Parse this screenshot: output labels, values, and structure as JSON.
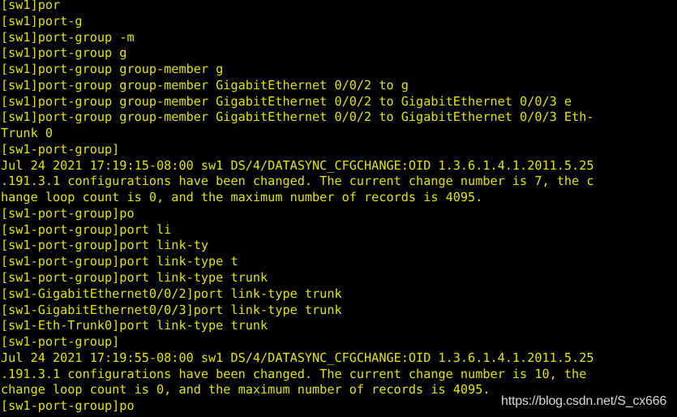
{
  "terminal": {
    "title": "Huawei VRP CLI session",
    "background_color": "#000000",
    "text_color": "#e3e300",
    "device_hostname": "sw1",
    "lines": [
      "[sw1]por",
      "[sw1]port-g",
      "[sw1]port-group -m",
      "[sw1]port-group g",
      "[sw1]port-group group-member g",
      "[sw1]port-group group-member GigabitEthernet 0/0/2 to g",
      "[sw1]port-group group-member GigabitEthernet 0/0/2 to GigabitEthernet 0/0/3 e",
      "[sw1]port-group group-member GigabitEthernet 0/0/2 to GigabitEthernet 0/0/3 Eth-",
      "Trunk 0",
      "[sw1-port-group]",
      "Jul 24 2021 17:19:15-08:00 sw1 DS/4/DATASYNC_CFGCHANGE:OID 1.3.6.1.4.1.2011.5.25",
      ".191.3.1 configurations have been changed. The current change number is 7, the c",
      "hange loop count is 0, and the maximum number of records is 4095.",
      "[sw1-port-group]po",
      "[sw1-port-group]port li",
      "[sw1-port-group]port link-ty",
      "[sw1-port-group]port link-type t",
      "[sw1-port-group]port link-type trunk",
      "[sw1-GigabitEthernet0/0/2]port link-type trunk",
      "[sw1-GigabitEthernet0/0/3]port link-type trunk",
      "[sw1-Eth-Trunk0]port link-type trunk",
      "[sw1-port-group]",
      "Jul 24 2021 17:19:55-08:00 sw1 DS/4/DATASYNC_CFGCHANGE:OID 1.3.6.1.4.1.2011.5.25",
      ".191.3.1 configurations have been changed. The current change number is 10, the ",
      "change loop count is 0, and the maximum number of records is 4095.",
      "[sw1-port-group]po"
    ]
  },
  "watermark": {
    "text": "https://blog.csdn.net/S_cx666",
    "color": "#d8d8d8"
  }
}
